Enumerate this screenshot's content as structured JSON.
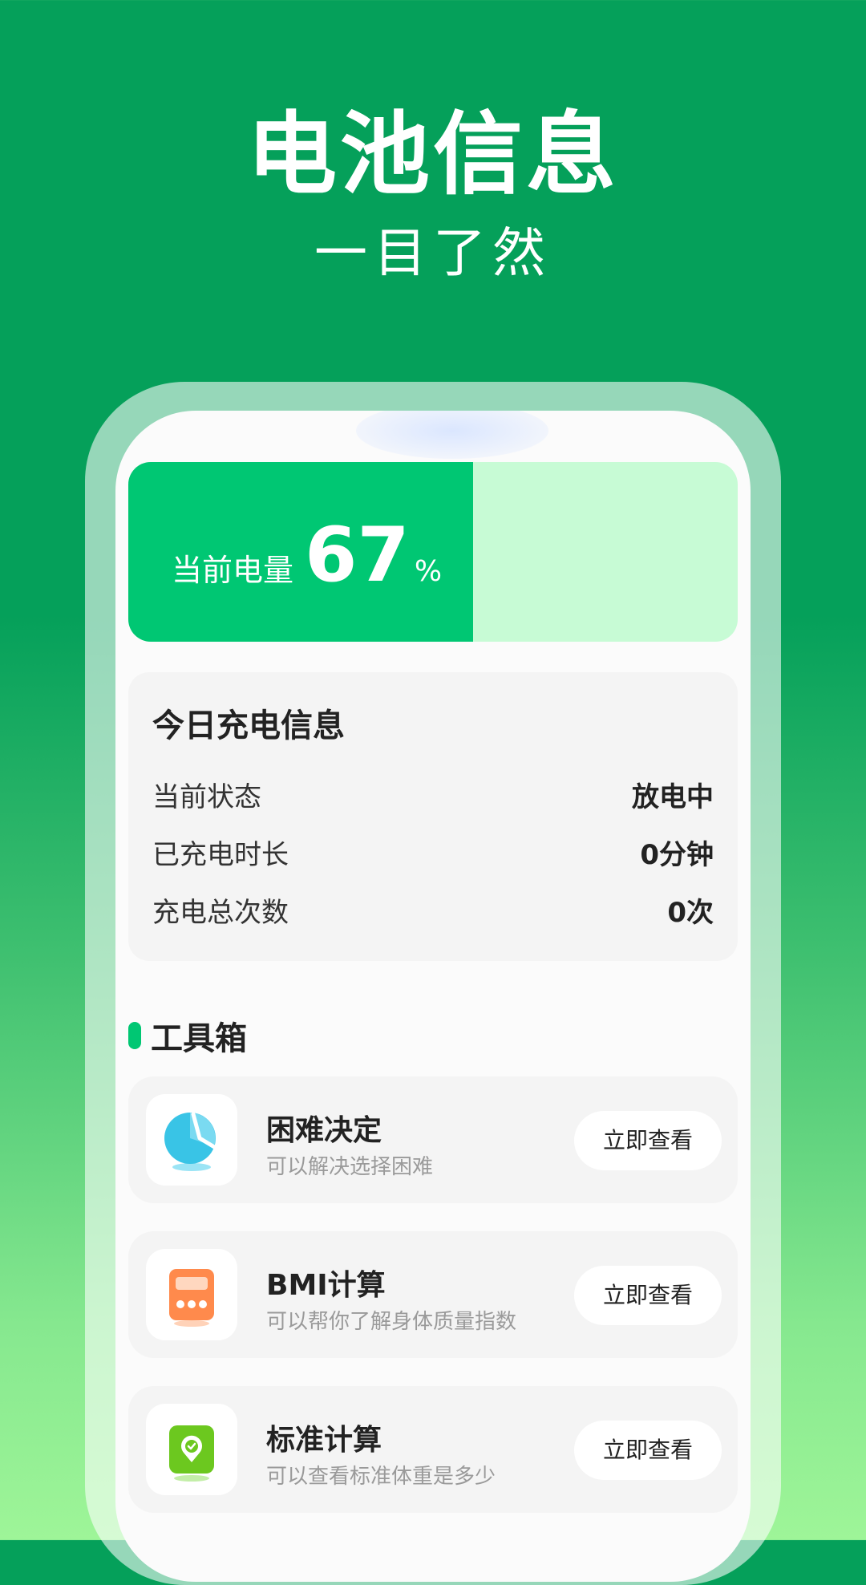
{
  "hero": {
    "title": "电池信息",
    "subtitle": "一目了然"
  },
  "battery": {
    "label": "当前电量",
    "level": 67,
    "value": "67",
    "unit": "%"
  },
  "charge_info": {
    "title": "今日充电信息",
    "rows": [
      {
        "label": "当前状态",
        "value": "放电中"
      },
      {
        "label": "已充电时长",
        "value": "0分钟"
      },
      {
        "label": "充电总次数",
        "value": "0次"
      }
    ]
  },
  "toolbox": {
    "title": "工具箱",
    "items": [
      {
        "name": "困难决定",
        "desc": "可以解决选择困难",
        "button": "立即查看",
        "icon": "pie-chart-icon"
      },
      {
        "name": "BMI计算",
        "desc": "可以帮你了解身体质量指数",
        "button": "立即查看",
        "icon": "calculator-icon"
      },
      {
        "name": "标准计算",
        "desc": "可以查看标准体重是多少",
        "button": "立即查看",
        "icon": "scale-check-icon"
      }
    ]
  },
  "colors": {
    "brand_green": "#05a05a",
    "battery_fill": "#00c773",
    "battery_empty": "#c7fbd5"
  }
}
